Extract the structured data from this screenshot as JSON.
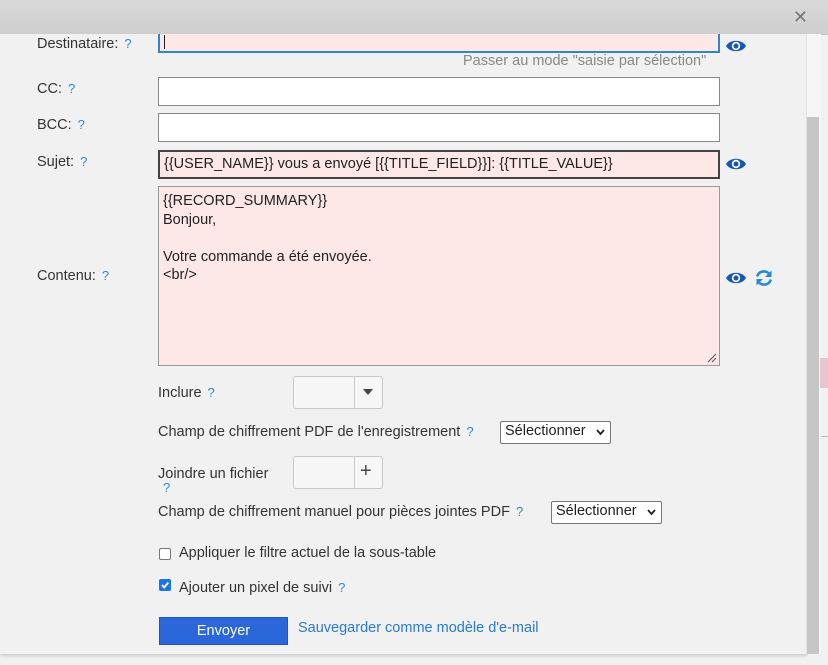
{
  "window": {
    "close_glyph": "✕"
  },
  "form": {
    "destinataire": {
      "label": "Destinataire:",
      "help": "?",
      "value": "",
      "mode_link": "Passer au mode \"saisie par sélection\""
    },
    "cc": {
      "label": "CC:",
      "help": "?",
      "value": ""
    },
    "bcc": {
      "label": "BCC:",
      "help": "?",
      "value": ""
    },
    "sujet": {
      "label": "Sujet:",
      "help": "?",
      "value": "{{USER_NAME}} vous a envoyé [{{TITLE_FIELD}}]: {{TITLE_VALUE}}"
    },
    "contenu": {
      "label": "Contenu:",
      "help": "?",
      "value": "{{RECORD_SUMMARY}}\nBonjour,\n\nVotre commande a été envoyée.\n<br/>"
    },
    "inclure": {
      "label": "Inclure",
      "help": "?"
    },
    "pdf_record": {
      "label": "Champ de chiffrement PDF de l'enregistrement",
      "help": "?",
      "selected": "Sélectionner"
    },
    "joindre": {
      "label": "Joindre un fichier",
      "help": "?",
      "plus": "+"
    },
    "pdf_manual": {
      "label": "Champ de chiffrement manuel pour pièces jointes PDF",
      "help": "?",
      "selected": "Sélectionner"
    },
    "apply_filter": {
      "label": "Appliquer le filtre actuel de la sous-table",
      "checked": false
    },
    "pixel": {
      "label": "Ajouter un pixel de suivi",
      "help": "?",
      "checked": true
    },
    "send_label": "Envoyer",
    "save_template_label": "Sauvegarder comme modèle d'e-mail"
  },
  "colors": {
    "accent": "#2b67db",
    "link": "#2a7ad1",
    "help": "#2a8ad4",
    "pink_field": "#fde7e7",
    "eye": "#1656b8"
  },
  "icons": [
    "close-icon",
    "eye-icon",
    "refresh-icon",
    "chevron-down-icon",
    "plus-icon",
    "resize-grip-icon",
    "checkmark-icon"
  ]
}
